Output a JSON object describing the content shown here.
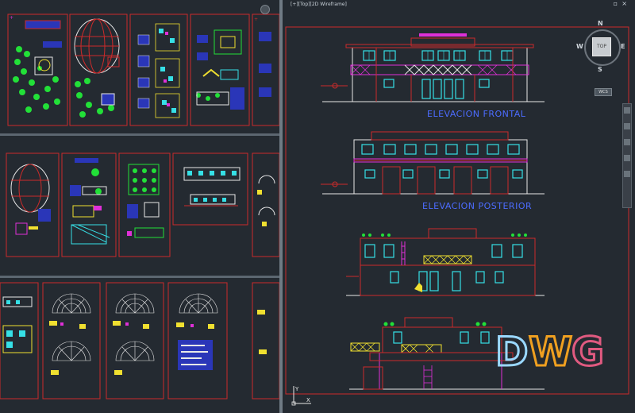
{
  "viewport": {
    "label": "[+][Top][2D Wireframe]",
    "close_glyph": "×",
    "restore_glyph": "▫"
  },
  "viewcube": {
    "north": "N",
    "south": "S",
    "east": "E",
    "west": "W",
    "face": "TOP",
    "coordinate_system": "WCS"
  },
  "drawing": {
    "front_elevation_title": "ELEVACION FRONTAL",
    "rear_elevation_title": "ELEVACION POSTERIOR"
  },
  "ucs": {
    "x_axis": "X",
    "y_axis": "Y"
  },
  "logo": {
    "letter_1": "D",
    "letter_2": "W",
    "letter_3": "G"
  },
  "colors": {
    "background": "#242a31",
    "sheet_border": "#cc2a2a",
    "window_cyan": "#36e0e6",
    "magenta": "#e030d8",
    "green": "#22e038",
    "yellow": "#f0e030",
    "blue_title": "#4c6cff",
    "white_line": "#e8e8e8"
  }
}
